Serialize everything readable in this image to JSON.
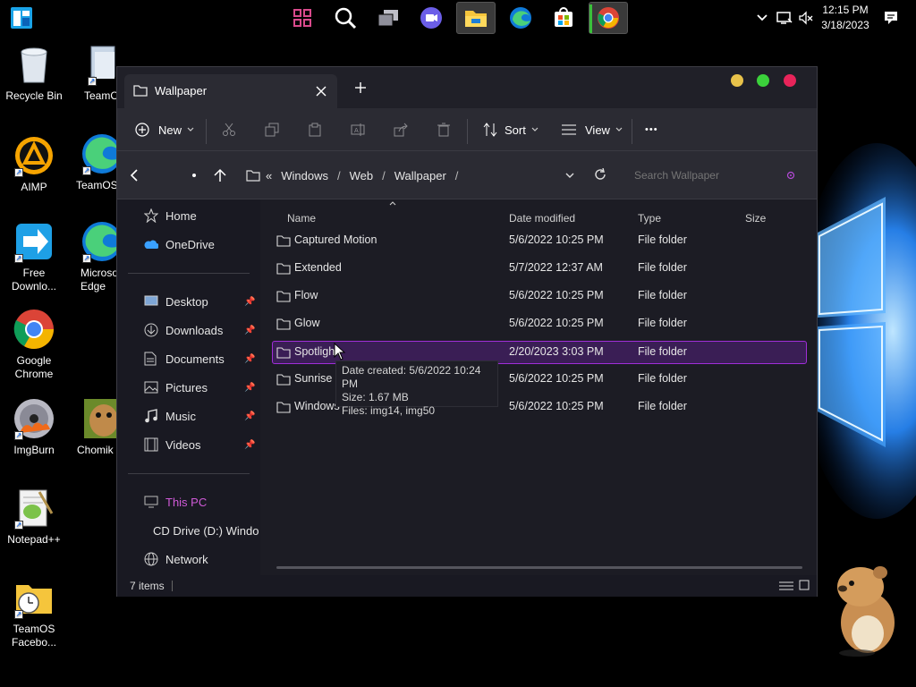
{
  "taskbar": {
    "apps": [
      {
        "name": "start",
        "icon": "windows-start-icon"
      },
      {
        "name": "widgets",
        "icon": "widgets-icon"
      },
      {
        "name": "search",
        "icon": "search-icon"
      },
      {
        "name": "task-view",
        "icon": "task-view-icon"
      },
      {
        "name": "chat",
        "icon": "chat-icon"
      },
      {
        "name": "file-explorer",
        "icon": "file-explorer-icon"
      },
      {
        "name": "edge",
        "icon": "edge-icon"
      },
      {
        "name": "store",
        "icon": "store-icon"
      },
      {
        "name": "chrome",
        "icon": "chrome-icon"
      }
    ],
    "clock_time": "12:15 PM",
    "clock_date": "3/18/2023"
  },
  "desktop": {
    "icons": [
      {
        "label": "Recycle Bin"
      },
      {
        "label": "TeamO"
      },
      {
        "label": "AIMP"
      },
      {
        "label": "TeamOS"
      },
      {
        "label": "Free Downlo..."
      },
      {
        "label": "Microso Edge"
      },
      {
        "label": "Google Chrome"
      },
      {
        "label": "ImgBurn"
      },
      {
        "label": "Chomik"
      },
      {
        "label": "Notepad++"
      },
      {
        "label": "TeamOS Facebo..."
      }
    ]
  },
  "explorer": {
    "tab_title": "Wallpaper",
    "toolbar": {
      "new_label": "New",
      "sort_label": "Sort",
      "view_label": "View",
      "more_label": "•••"
    },
    "breadcrumb": [
      "Windows",
      "Web",
      "Wallpaper"
    ],
    "breadcrumb_prefix": "«",
    "search_placeholder": "Search Wallpaper",
    "nav": {
      "home": "Home",
      "onedrive": "OneDrive",
      "quick": [
        "Desktop",
        "Downloads",
        "Documents",
        "Pictures",
        "Music",
        "Videos"
      ],
      "this_pc": "This PC",
      "cd_drive": "CD Drive (D:) Windo",
      "network": "Network"
    },
    "columns": {
      "name": "Name",
      "date": "Date modified",
      "type": "Type",
      "size": "Size"
    },
    "rows": [
      {
        "name": "Captured Motion",
        "date": "5/6/2022 10:25 PM",
        "type": "File folder"
      },
      {
        "name": "Extended",
        "date": "5/7/2022 12:37 AM",
        "type": "File folder"
      },
      {
        "name": "Flow",
        "date": "5/6/2022 10:25 PM",
        "type": "File folder"
      },
      {
        "name": "Glow",
        "date": "5/6/2022 10:25 PM",
        "type": "File folder"
      },
      {
        "name": "Spotlight",
        "date": "2/20/2023 3:03 PM",
        "type": "File folder"
      },
      {
        "name": "Sunrise",
        "date": "5/6/2022 10:25 PM",
        "type": "File folder"
      },
      {
        "name": "Windows",
        "date": "5/6/2022 10:25 PM",
        "type": "File folder"
      }
    ],
    "tooltip": {
      "line1": "Date created: 5/6/2022 10:24 PM",
      "line2": "Size: 1.67 MB",
      "line3": "Files: img14, img50"
    },
    "status": "7 items",
    "colors": {
      "accent": "#a02ed8",
      "selection": "#3a1e55",
      "this_pc": "#d05ad8",
      "window_close": "#e8245a",
      "window_max": "#3bd13b",
      "window_min": "#e8c24a"
    }
  }
}
